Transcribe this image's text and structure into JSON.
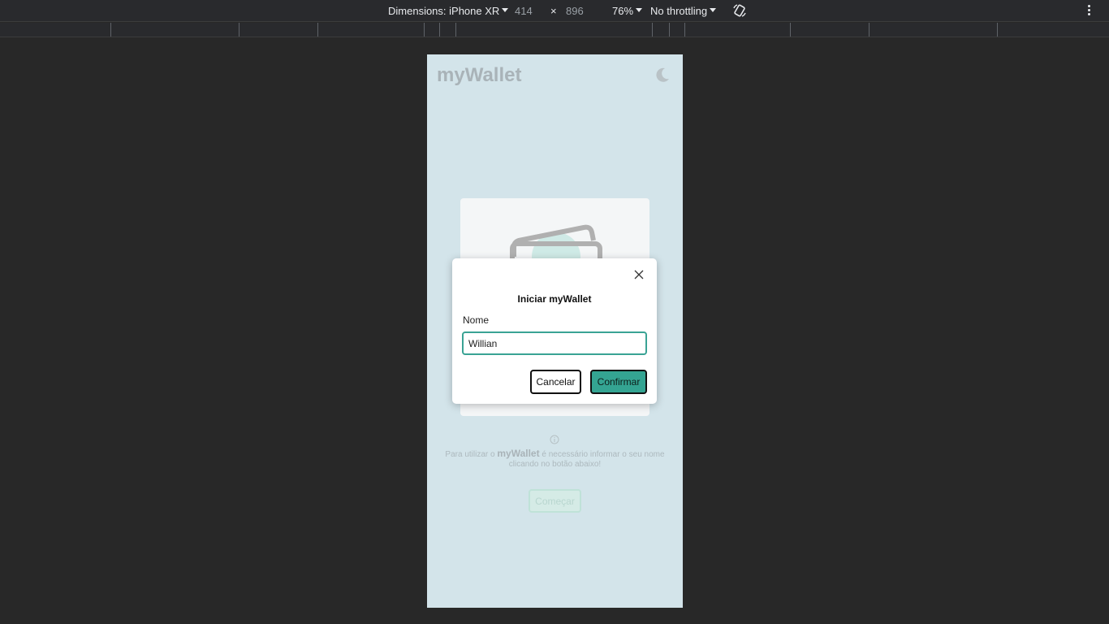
{
  "devtools": {
    "device_label": "Dimensions: iPhone XR",
    "width_value": "414",
    "times": "×",
    "height_value": "896",
    "zoom": "76%",
    "throttling": "No throttling"
  },
  "app": {
    "brand": "myWallet",
    "info_prefix": "Para utilizar o",
    "info_brand": "myWallet",
    "info_suffix": "é necessário informar o seu nome clicando no botão abaixo!",
    "start_button": "Começar"
  },
  "modal": {
    "title": "Iniciar myWallet",
    "name_label": "Nome",
    "name_value": "Willian",
    "cancel_label": "Cancelar",
    "confirm_label": "Confirmar"
  },
  "colors": {
    "device_bg": "#d3e4ea",
    "accent": "#34a492",
    "input_border": "#3aa394"
  }
}
